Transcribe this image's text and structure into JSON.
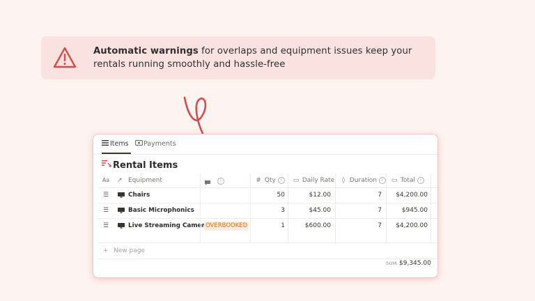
{
  "banner": {
    "bold_text": "Automatic warnings",
    "text": " for overlaps and equipment issues keep your rentals running smoothly and hassle-free",
    "icon": "warning-triangle-icon",
    "accent_color": "#d44c47"
  },
  "tabs": [
    {
      "label": "Items",
      "icon": "list-icon",
      "active": true
    },
    {
      "label": "Payments",
      "icon": "money-icon",
      "active": false
    }
  ],
  "database": {
    "title": "Rental Items",
    "icon": "list-sorting-icon",
    "columns": {
      "name_type": "Aa",
      "equipment": "Equipment",
      "qty": "Qty",
      "daily_rate": "Daily Rate",
      "duration": "Duration",
      "total": "Total"
    },
    "rows": [
      {
        "name": "Chairs",
        "flag": "",
        "qty": "50",
        "rate": "$12.00",
        "duration": "7",
        "total": "$4,200.00"
      },
      {
        "name": "Basic Microphonics",
        "flag": "",
        "qty": "3",
        "rate": "$45.00",
        "duration": "7",
        "total": "$945.00"
      },
      {
        "name": "Live Streaming Cameras",
        "flag": "OVERBOOKED",
        "qty": "1",
        "rate": "$600.00",
        "duration": "7",
        "total": "$4,200.00"
      }
    ],
    "new_page_label": "New page",
    "sum_label": "SUM",
    "sum_value": "$9,345.00"
  }
}
